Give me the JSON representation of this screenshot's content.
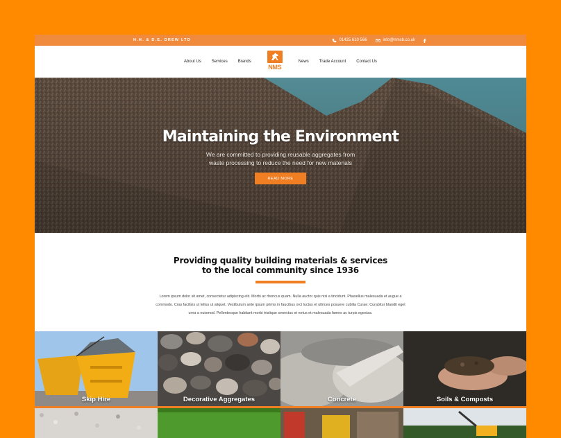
{
  "topbar": {
    "company": "H.H. & D.E. DREW LTD",
    "phone": "01425 610 566",
    "email": "info@nmsb.co.uk",
    "social_icon": "facebook-icon"
  },
  "nav": {
    "left": [
      "About Us",
      "Services",
      "Brands"
    ],
    "logo_text": "NMS",
    "right": [
      "News",
      "Trade Account",
      "Contact Us"
    ]
  },
  "hero": {
    "title": "Maintaining the Environment",
    "text": "We are committed to providing reusable aggregates from waste processing to reduce the need for new materials",
    "button": "READ MORE"
  },
  "intro": {
    "heading_line1": "Providing quality building materials & services",
    "heading_line2": "to the local community since 1936",
    "body": "Lorem ipsum dolor sit amet, consectetur adipiscing elit. Morbi ac rhoncus quam. Nulla auctor quis nisi a tincidunt. Phasellus malesuada et augue a commodo. Cras facilisis ut tellus ut aliquet. Vestibulum ante ipsum primis in faucibus orci luctus et ultrices posuere cubilia Curae; Curabitur blandit eget urna a euismod. Pellentesque habitant morbi tristique senectus et netus et malesuada fames ac turpis egestas."
  },
  "services": [
    {
      "label": "Skip Hire"
    },
    {
      "label": "Decorative Aggregates"
    },
    {
      "label": "Concrete"
    },
    {
      "label": "Soils & Composts"
    }
  ],
  "colors": {
    "accent": "#f07e22",
    "page_background": "#ff8a00",
    "topbar": "#f08a3c"
  }
}
